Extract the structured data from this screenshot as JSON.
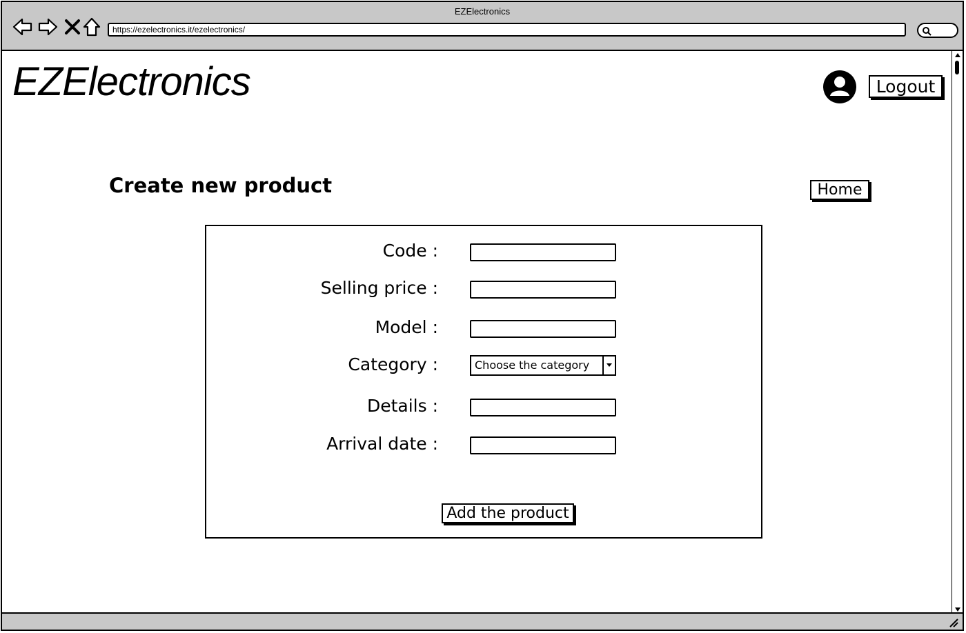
{
  "window": {
    "title": "EZElectronics",
    "url": "https://ezelectronics.it/ezelectronics/"
  },
  "header": {
    "brand": "EZElectronics",
    "logout_label": "Logout"
  },
  "page": {
    "title": "Create new product",
    "home_label": "Home"
  },
  "form": {
    "fields": [
      {
        "label": "Code :",
        "value": ""
      },
      {
        "label": "Selling price :",
        "value": ""
      },
      {
        "label": "Model :",
        "value": ""
      },
      {
        "label": "Category :",
        "selected": "Choose the category"
      },
      {
        "label": "Details :",
        "value": ""
      },
      {
        "label": "Arrival date :",
        "value": ""
      }
    ],
    "submit_label": "Add the product"
  },
  "icons": {
    "back": "arrow-left-icon",
    "forward": "arrow-right-icon",
    "stop": "close-icon",
    "home": "home-icon",
    "search": "search-icon",
    "user": "user-avatar-icon",
    "dropdown": "chevron-down-icon"
  }
}
